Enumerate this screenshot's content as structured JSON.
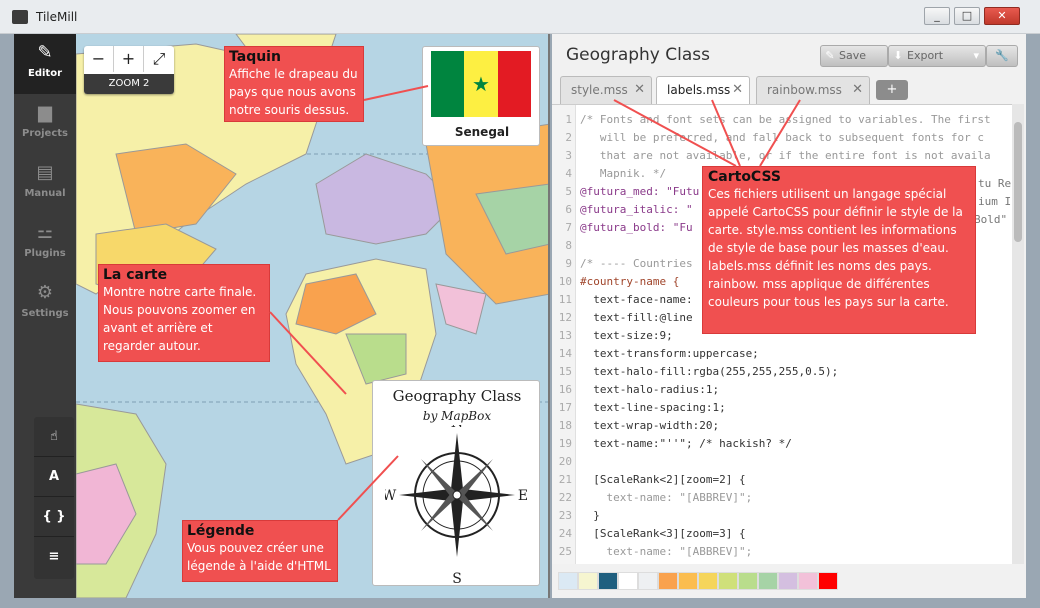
{
  "window": {
    "title": "TileMill",
    "controls": [
      "_",
      "□",
      "✕"
    ]
  },
  "sidebar": {
    "items": [
      {
        "label": "Editor",
        "icon": "pencil-icon",
        "active": true
      },
      {
        "label": "Projects",
        "icon": "folder-icon",
        "active": false
      },
      {
        "label": "Manual",
        "icon": "book-icon",
        "active": false
      },
      {
        "label": "Plugins",
        "icon": "plug-icon",
        "active": false
      },
      {
        "label": "Settings",
        "icon": "gear-icon",
        "active": false
      }
    ]
  },
  "map": {
    "zoom_minus": "−",
    "zoom_plus": "+",
    "fullscreen": "⤢",
    "zoom_label": "ZOOM 2",
    "tools": [
      {
        "glyph": "☝",
        "icon": "hand-icon"
      },
      {
        "glyph": "A",
        "icon": "text-icon"
      },
      {
        "glyph": "{ }",
        "icon": "braces-icon"
      },
      {
        "glyph": "≡",
        "icon": "layers-icon"
      }
    ],
    "tooltip_country": "Senegal",
    "legend": {
      "title": "Geography Class",
      "subtitle": "by MapBox"
    },
    "compass": {
      "n": "N",
      "s": "S",
      "e": "E",
      "w": "W"
    }
  },
  "editor": {
    "title": "Geography Class",
    "save_label": "Save",
    "export_label": "Export",
    "tabs": [
      {
        "label": "style.mss",
        "active": false
      },
      {
        "label": "labels.mss",
        "active": true
      },
      {
        "label": "rainbow.mss",
        "active": false
      }
    ],
    "add_tab": "+",
    "lines": [
      {
        "n": "1",
        "t": "/* Fonts and font sets can be assigned to variables. The first"
      },
      {
        "n": "2",
        "t": "   will be preferred, and fall back to subsequent fonts for c"
      },
      {
        "n": "3",
        "t": "   that are not available, or if the entire font is not availa"
      },
      {
        "n": "4",
        "t": "   Mapnik. */"
      },
      {
        "n": "5",
        "t": "@futura_med: \"Futu"
      },
      {
        "n": "6",
        "t": "@futura_italic: \""
      },
      {
        "n": "7",
        "t": "@futura_bold: \"Fu"
      },
      {
        "n": "8",
        "t": ""
      },
      {
        "n": "9",
        "t": "/* ---- Countries"
      },
      {
        "n": "10",
        "t": "#country-name {"
      },
      {
        "n": "11",
        "t": "  text-face-name:"
      },
      {
        "n": "12",
        "t": "  text-fill:@line"
      },
      {
        "n": "13",
        "t": "  text-size:9;"
      },
      {
        "n": "14",
        "t": "  text-transform:uppercase;"
      },
      {
        "n": "15",
        "t": "  text-halo-fill:rgba(255,255,255,0.5);"
      },
      {
        "n": "16",
        "t": "  text-halo-radius:1;"
      },
      {
        "n": "17",
        "t": "  text-line-spacing:1;"
      },
      {
        "n": "18",
        "t": "  text-wrap-width:20;"
      },
      {
        "n": "19",
        "t": "  text-name:\"''\"; /* hackish? */"
      },
      {
        "n": "20",
        "t": ""
      },
      {
        "n": "21",
        "t": "  [ScaleRank<2][zoom=2] {"
      },
      {
        "n": "22",
        "t": "    text-name: \"[ABBREV]\";"
      },
      {
        "n": "23",
        "t": "  }"
      },
      {
        "n": "24",
        "t": "  [ScaleRank<3][zoom=3] {"
      },
      {
        "n": "25",
        "t": "    text-name: \"[ABBREV]\";"
      }
    ],
    "overflow_text": {
      "l5": "tu Re",
      "l6": "ium I",
      "l7": "Bold\""
    },
    "swatches": [
      "#dbe9f4",
      "#f6f5d0",
      "#1f5f7f",
      "#ffffff",
      "#eef0f2",
      "#f9a24e",
      "#fbbd4f",
      "#f5d55b",
      "#cfe07a",
      "#b9dd8c",
      "#a6d3a6",
      "#d4bfe0",
      "#f2c1d9",
      "#ff0000"
    ]
  },
  "callouts": [
    {
      "title": "Taquin",
      "body": "Affiche le drapeau du pays que nous avons notre souris dessus."
    },
    {
      "title": "La carte",
      "body": "Montre notre carte finale. Nous pouvons zoomer en avant et arrière et regarder autour."
    },
    {
      "title": "Légende",
      "body": "Vous pouvez créer une légende à l'aide d'HTML"
    },
    {
      "title": "CartoCSS",
      "body": "Ces fichiers utilisent un langage spécial appelé CartoCSS pour définir le style de la carte. style.mss contient les informations de style de base pour les masses d'eau. labels.mss définit les noms des pays. rainbow. mss applique de différentes couleurs pour tous les pays sur la carte."
    }
  ],
  "colors": {
    "callout": "#f05050",
    "sidebar": "#3a3a3a",
    "ocean": "#b6d5e4",
    "senegal_green": "#00853f",
    "senegal_yellow": "#fdef42",
    "senegal_red": "#e31b23"
  }
}
